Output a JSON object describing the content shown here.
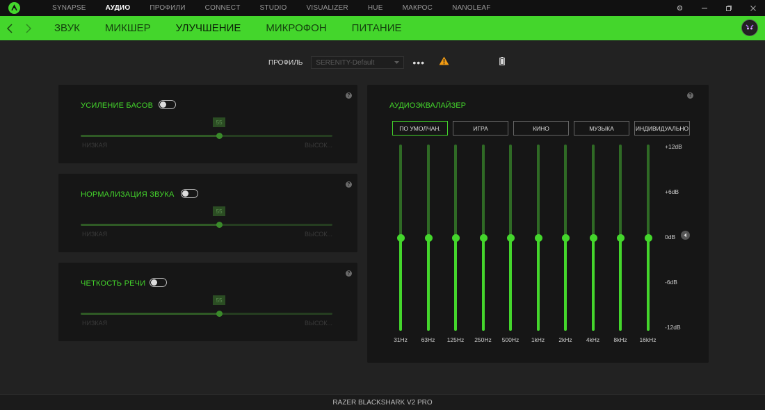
{
  "topnav": {
    "items": [
      "SYNAPSE",
      "АУДИО",
      "ПРОФИЛИ",
      "CONNECT",
      "STUDIO",
      "VISUALIZER",
      "HUE",
      "МАКРОС",
      "NANOLEAF"
    ],
    "active": "АУДИО"
  },
  "subnav": {
    "items": [
      "ЗВУК",
      "МИКШЕР",
      "УЛУЧШЕНИЕ",
      "МИКРОФОН",
      "ПИТАНИЕ"
    ],
    "active": "УЛУЧШЕНИЕ"
  },
  "profile": {
    "label": "ПРОФИЛЬ",
    "value": "SERENITY-Default",
    "more": "•••"
  },
  "enhancements": [
    {
      "title": "УСИЛЕНИЕ БАСОВ",
      "enabled": false,
      "value": "55",
      "min_label": "НИЗКАЯ",
      "max_label": "ВЫСОК..."
    },
    {
      "title": "НОРМАЛИЗАЦИЯ ЗВУКА",
      "enabled": false,
      "value": "55",
      "min_label": "НИЗКАЯ",
      "max_label": "ВЫСОК..."
    },
    {
      "title": "ЧЕТКОСТЬ РЕЧИ",
      "enabled": false,
      "value": "55",
      "min_label": "НИЗКАЯ",
      "max_label": "ВЫСОК..."
    }
  ],
  "equalizer": {
    "title": "АУДИОЭКВАЛАЙЗЕР",
    "presets": [
      "ПО УМОЛЧАН.",
      "ИГРА",
      "КИНО",
      "МУЗЫКА",
      "ИНДИВИДУАЛЬНО"
    ],
    "active_preset": "ПО УМОЛЧАН.",
    "bands": [
      "31Hz",
      "63Hz",
      "125Hz",
      "250Hz",
      "500Hz",
      "1kHz",
      "2kHz",
      "4kHz",
      "8kHz",
      "16kHz"
    ],
    "gains_db": [
      0,
      0,
      0,
      0,
      0,
      0,
      0,
      0,
      0,
      0
    ],
    "db_scale": [
      "+12dB",
      "+6dB",
      "0dB",
      "-6dB",
      "-12dB"
    ]
  },
  "footer": {
    "device": "RAZER BLACKSHARK V2 PRO"
  },
  "colors": {
    "accent": "#44d62c",
    "warning": "#f39c12"
  }
}
